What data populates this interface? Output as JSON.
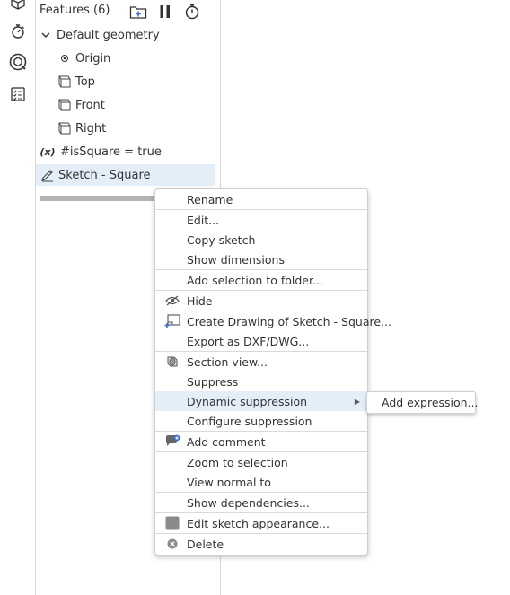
{
  "colors": {
    "selected_bg": "#e3eef9",
    "accent": "#3b6fd8"
  },
  "rail": {
    "icons": [
      "cube-icon",
      "stopwatch-icon",
      "inspect-icon",
      "checklist-icon"
    ]
  },
  "panel": {
    "title": "Features (6)",
    "header_buttons": [
      "add-folder-icon",
      "pause-icon",
      "stopwatch-icon"
    ],
    "tree": {
      "default_geometry": "Default geometry",
      "origin": "Origin",
      "top": "Top",
      "front": "Front",
      "right": "Right",
      "variable": "#isSquare = true",
      "variable_icon_text": "(x)",
      "sketch": "Sketch - Square"
    }
  },
  "context_menu": {
    "items": [
      {
        "label": "Rename",
        "icon": ""
      },
      {
        "label": "Edit...",
        "icon": ""
      },
      {
        "label": "Copy sketch",
        "icon": ""
      },
      {
        "label": "Show dimensions",
        "icon": ""
      },
      {
        "label": "Add selection to folder...",
        "icon": ""
      },
      {
        "label": "Hide",
        "icon": "hide-icon"
      },
      {
        "label": "Create Drawing of Sketch - Square...",
        "icon": "drawing-icon"
      },
      {
        "label": "Export as DXF/DWG...",
        "icon": ""
      },
      {
        "label": "Section view...",
        "icon": "section-view-icon"
      },
      {
        "label": "Suppress",
        "icon": ""
      },
      {
        "label": "Dynamic suppression",
        "icon": "",
        "has_submenu": true
      },
      {
        "label": "Configure suppression",
        "icon": ""
      },
      {
        "label": "Add comment",
        "icon": "comment-icon"
      },
      {
        "label": "Zoom to selection",
        "icon": ""
      },
      {
        "label": "View normal to",
        "icon": ""
      },
      {
        "label": "Show dependencies...",
        "icon": ""
      },
      {
        "label": "Edit sketch appearance...",
        "icon": "appearance-icon"
      },
      {
        "label": "Delete",
        "icon": "delete-icon"
      }
    ]
  },
  "submenu": {
    "items": [
      {
        "label": "Add expression..."
      }
    ]
  }
}
